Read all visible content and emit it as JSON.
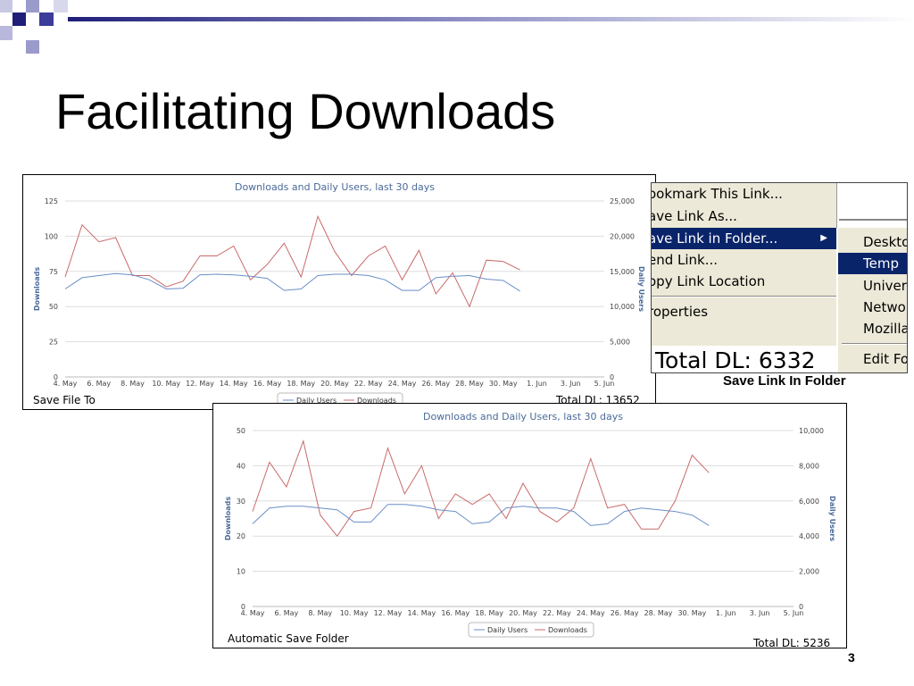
{
  "slide": {
    "title": "Facilitating Downloads",
    "page_number": "3",
    "accent_colors": [
      "#1f1f7a",
      "#3c3c9a",
      "#9a9acb",
      "#c8c8e4"
    ]
  },
  "chart1": {
    "caption_left": "Save File To",
    "caption_right": "Total DL: 13652"
  },
  "chart2": {
    "caption_left": "Automatic Save Folder",
    "caption_right": "Total DL: 5236"
  },
  "menu": {
    "items": [
      "ookmark This Link...",
      "ave Link As...",
      "ave Link in Folder...",
      "end Link...",
      "opy Link Location",
      "roperties"
    ],
    "highlighted_index": 2,
    "submenu": [
      "Deskto",
      "Temp",
      "Univers",
      "Networ",
      "Mozilla",
      "Edit Fo"
    ],
    "submenu_highlighted_index": 1,
    "total_text": "Total DL: 6332",
    "caption": "Save Link In Folder"
  },
  "chart_data": [
    {
      "type": "line",
      "title": "Downloads and Daily Users, last 30 days",
      "ylabel": "Downloads",
      "y2label": "Daily Users",
      "ylim": [
        0,
        125
      ],
      "y2lim": [
        0,
        25000
      ],
      "yticks": [
        "0",
        "25",
        "50",
        "75",
        "100",
        "125"
      ],
      "y2ticks": [
        "0",
        "5,000",
        "10,000",
        "15,000",
        "20,000",
        "25,000"
      ],
      "xticks": [
        "4. May",
        "6. May",
        "8. May",
        "10. May",
        "12. May",
        "14. May",
        "16. May",
        "18. May",
        "20. May",
        "22. May",
        "24. May",
        "26. May",
        "28. May",
        "30. May",
        "1. Jun",
        "3. Jun",
        "5. Jun"
      ],
      "legend": [
        "Daily Users",
        "Downloads"
      ],
      "legend_position": "bottom",
      "grid": true,
      "colors": {
        "daily_users": "#6a8fc7",
        "downloads": "#c96a6a"
      },
      "series": [
        {
          "name": "Downloads",
          "axis": "left",
          "values": [
            71,
            108,
            96,
            99,
            72,
            72,
            64,
            68,
            86,
            86,
            93,
            69,
            80,
            95,
            71,
            114,
            89,
            72,
            86,
            93,
            69,
            90,
            59,
            74,
            50,
            83,
            82,
            76
          ]
        },
        {
          "name": "Daily Users",
          "axis": "right",
          "values": [
            12500,
            14100,
            14400,
            14700,
            14500,
            13800,
            12500,
            12600,
            14500,
            14600,
            14500,
            14300,
            14000,
            12300,
            12500,
            14400,
            14600,
            14600,
            14400,
            13800,
            12300,
            12300,
            14100,
            14300,
            14400,
            13900,
            13700,
            12200
          ]
        }
      ]
    },
    {
      "type": "line",
      "title": "Downloads and Daily Users, last 30 days",
      "ylabel": "Downloads",
      "y2label": "Daily Users",
      "ylim": [
        0,
        50
      ],
      "y2lim": [
        0,
        10000
      ],
      "yticks": [
        "0",
        "10",
        "20",
        "30",
        "40",
        "50"
      ],
      "y2ticks": [
        "0",
        "2,000",
        "4,000",
        "6,000",
        "8,000",
        "10,000"
      ],
      "xticks": [
        "4. May",
        "6. May",
        "8. May",
        "10. May",
        "12. May",
        "14. May",
        "16. May",
        "18. May",
        "20. May",
        "22. May",
        "24. May",
        "26. May",
        "28. May",
        "30. May",
        "1. Jun",
        "3. Jun",
        "5. Jun"
      ],
      "legend": [
        "Daily Users",
        "Downloads"
      ],
      "legend_position": "bottom",
      "grid": true,
      "colors": {
        "daily_users": "#6a8fc7",
        "downloads": "#c96a6a"
      },
      "series": [
        {
          "name": "Downloads",
          "axis": "left",
          "values": [
            27,
            41,
            34,
            47,
            26,
            20,
            27,
            28,
            45,
            32,
            40,
            25,
            32,
            29,
            32,
            25,
            35,
            27,
            24,
            28,
            42,
            28,
            29,
            22,
            22,
            30,
            43,
            38
          ]
        },
        {
          "name": "Daily Users",
          "axis": "right",
          "values": [
            4700,
            5600,
            5700,
            5700,
            5600,
            5500,
            4800,
            4800,
            5800,
            5800,
            5700,
            5500,
            5400,
            4700,
            4800,
            5600,
            5700,
            5600,
            5600,
            5400,
            4600,
            4700,
            5400,
            5600,
            5500,
            5400,
            5200,
            4600
          ]
        }
      ]
    }
  ]
}
